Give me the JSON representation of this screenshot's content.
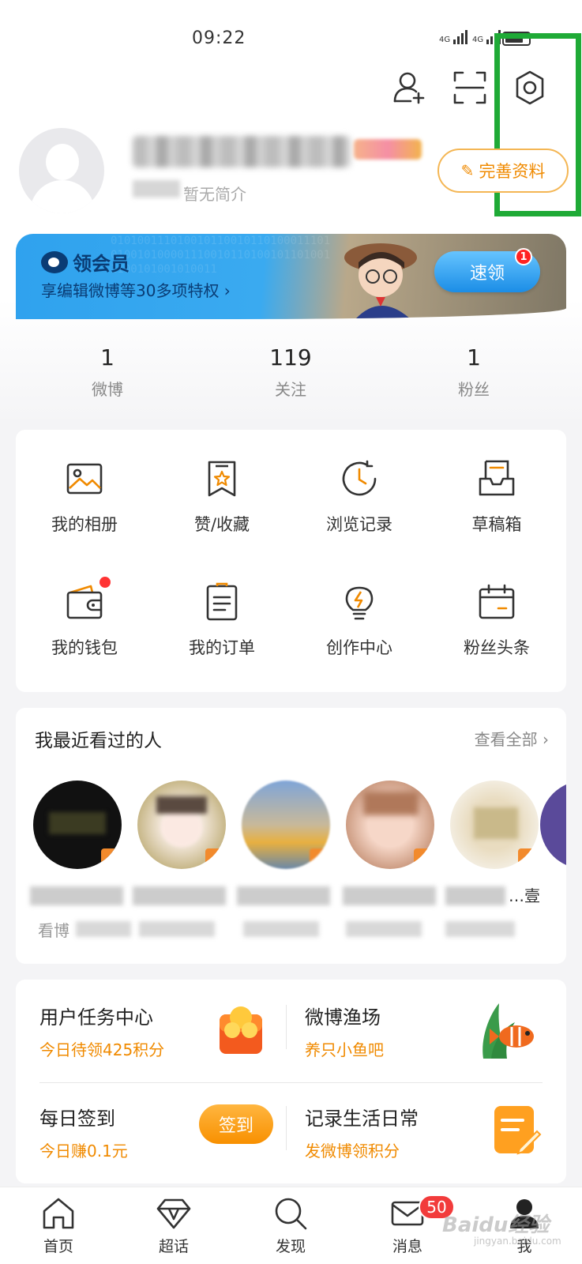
{
  "status_bar": {
    "time": "09:22",
    "network_1": "4G",
    "network_2": "4G"
  },
  "top_actions": {
    "add_friend_icon": "add-user-icon",
    "scan_icon": "scan-icon",
    "settings_icon": "gear-icon"
  },
  "profile": {
    "intro": "暂无简介",
    "edit_label": "完善资料"
  },
  "vip_banner": {
    "title": "领会员",
    "subtitle": "享编辑微博等30多项特权 ›",
    "button": "速领",
    "badge": "1",
    "bits": "0101001110100101100101101000111010100101000011100101101001011010011100101001010011"
  },
  "stats": [
    {
      "value": "1",
      "label": "微博"
    },
    {
      "value": "119",
      "label": "关注"
    },
    {
      "value": "1",
      "label": "粉丝"
    }
  ],
  "grid": [
    {
      "label": "我的相册",
      "icon": "photo-album-icon"
    },
    {
      "label": "赞/收藏",
      "icon": "bookmark-star-icon"
    },
    {
      "label": "浏览记录",
      "icon": "history-clock-icon"
    },
    {
      "label": "草稿箱",
      "icon": "draft-box-icon"
    },
    {
      "label": "我的钱包",
      "icon": "wallet-icon"
    },
    {
      "label": "我的订单",
      "icon": "order-list-icon"
    },
    {
      "label": "创作中心",
      "icon": "lightbulb-icon"
    },
    {
      "label": "粉丝头条",
      "icon": "calendar-icon"
    }
  ],
  "recent": {
    "title": "我最近看过的人",
    "see_all": "查看全部 ›",
    "first_sub": "看博",
    "last_name": "…壹"
  },
  "tasks": [
    {
      "title": "用户任务中心",
      "subtitle": "今日待领425积分"
    },
    {
      "title": "微博渔场",
      "subtitle": "养只小鱼吧"
    },
    {
      "title": "每日签到",
      "subtitle": "今日赚0.1元"
    },
    {
      "title": "记录生活日常",
      "subtitle": "发微博领积分"
    }
  ],
  "sign_button": "签到",
  "tabbar": [
    {
      "label": "首页",
      "icon": "home-icon"
    },
    {
      "label": "超话",
      "icon": "diamond-icon"
    },
    {
      "label": "发现",
      "icon": "search-icon"
    },
    {
      "label": "消息",
      "icon": "mail-icon"
    },
    {
      "label": "我",
      "icon": "profile-icon"
    }
  ],
  "message_badge": "50",
  "watermark": "Baidu经验",
  "watermark_sub": "jingyan.baidu.com",
  "colors": {
    "accent_orange": "#f08a00",
    "highlight_green": "#1faa36",
    "vip_blue": "#2fa2ee",
    "badge_red": "#f23b3b"
  }
}
